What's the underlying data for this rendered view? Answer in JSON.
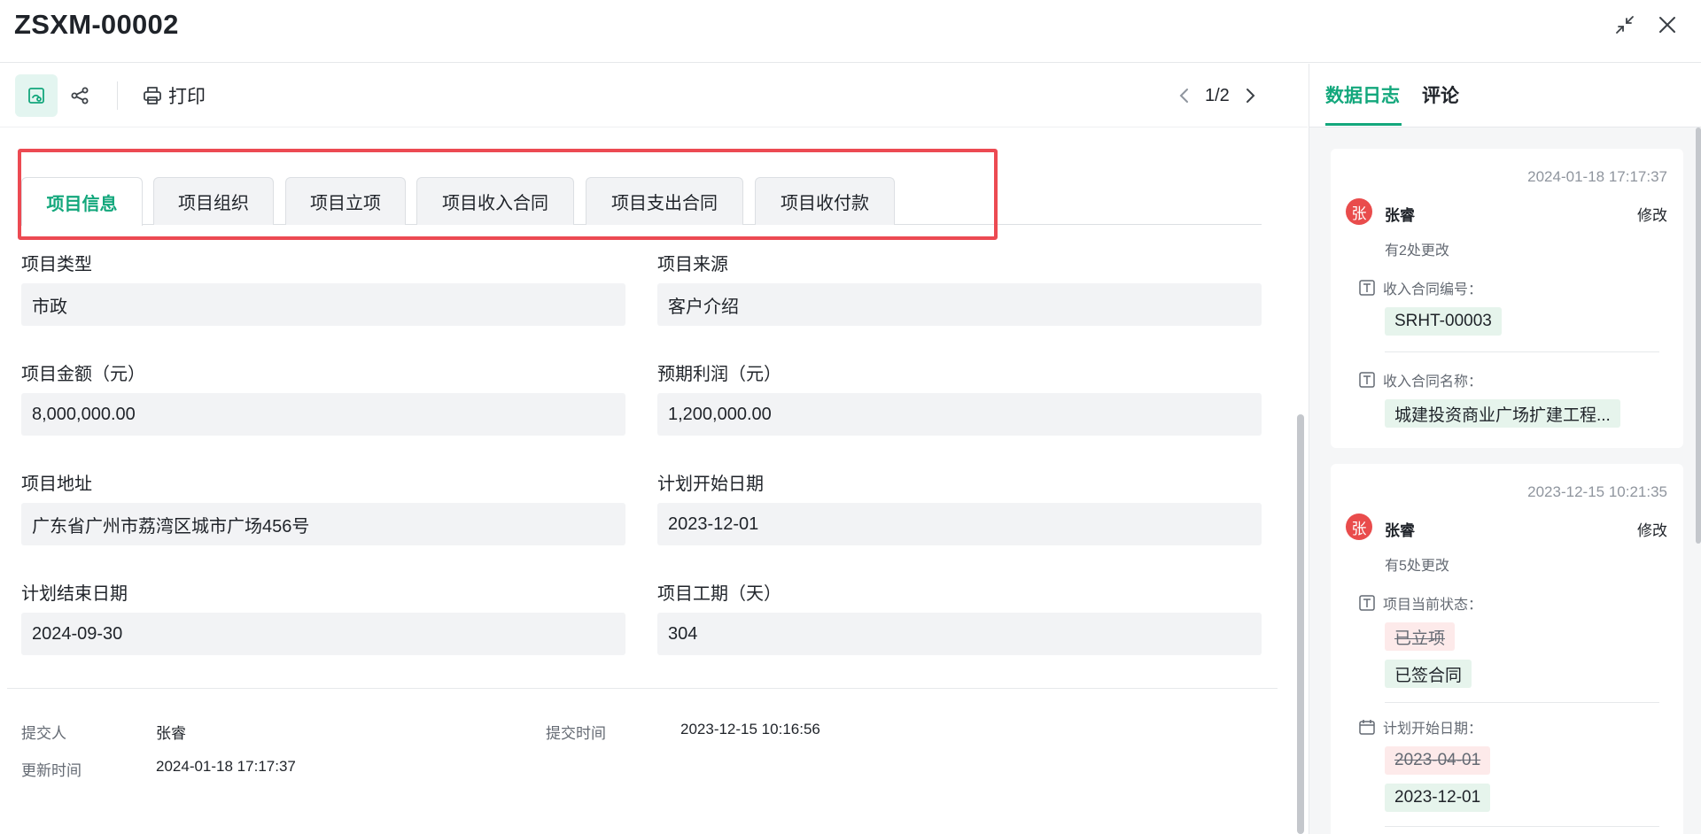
{
  "window": {
    "title": "ZSXM-00002"
  },
  "toolbar": {
    "print_label": "打印",
    "pager": "1/2"
  },
  "tabs": [
    {
      "label": "项目信息"
    },
    {
      "label": "项目组织"
    },
    {
      "label": "项目立项"
    },
    {
      "label": "项目收入合同"
    },
    {
      "label": "项目支出合同"
    },
    {
      "label": "项目收付款"
    }
  ],
  "fields": {
    "project_type": {
      "label": "项目类型",
      "value": "市政"
    },
    "project_source": {
      "label": "项目来源",
      "value": "客户介绍"
    },
    "project_amount": {
      "label": "项目金额（元）",
      "value": "8,000,000.00"
    },
    "expected_profit": {
      "label": "预期利润（元）",
      "value": "1,200,000.00"
    },
    "project_address": {
      "label": "项目地址",
      "value": "广东省广州市荔湾区城市广场456号"
    },
    "plan_start": {
      "label": "计划开始日期",
      "value": "2023-12-01"
    },
    "plan_end": {
      "label": "计划结束日期",
      "value": "2024-09-30"
    },
    "duration": {
      "label": "项目工期（天）",
      "value": "304"
    }
  },
  "meta": {
    "submitter_label": "提交人",
    "submitter": "张睿",
    "submit_time_label": "提交时间",
    "submit_time": "2023-12-15 10:16:56",
    "update_time_label": "更新时间",
    "update_time": "2024-01-18 17:17:37"
  },
  "side": {
    "tabs": [
      "数据日志",
      "评论"
    ],
    "logs": [
      {
        "time": "2024-01-18 17:17:37",
        "avatar": "张",
        "user": "张睿",
        "action": "修改",
        "summary": "有2处更改",
        "changes": [
          {
            "field": "收入合同编号：",
            "new": "SRHT-00003"
          },
          {
            "field": "收入合同名称：",
            "new": "城建投资商业广场扩建工程..."
          }
        ]
      },
      {
        "time": "2023-12-15 10:21:35",
        "avatar": "张",
        "user": "张睿",
        "action": "修改",
        "summary": "有5处更改",
        "changes": [
          {
            "field": "项目当前状态：",
            "old": "已立项",
            "new": "已签合同"
          },
          {
            "field": "计划开始日期：",
            "old": "2023-04-01",
            "new": "2023-12-01"
          }
        ]
      }
    ]
  }
}
